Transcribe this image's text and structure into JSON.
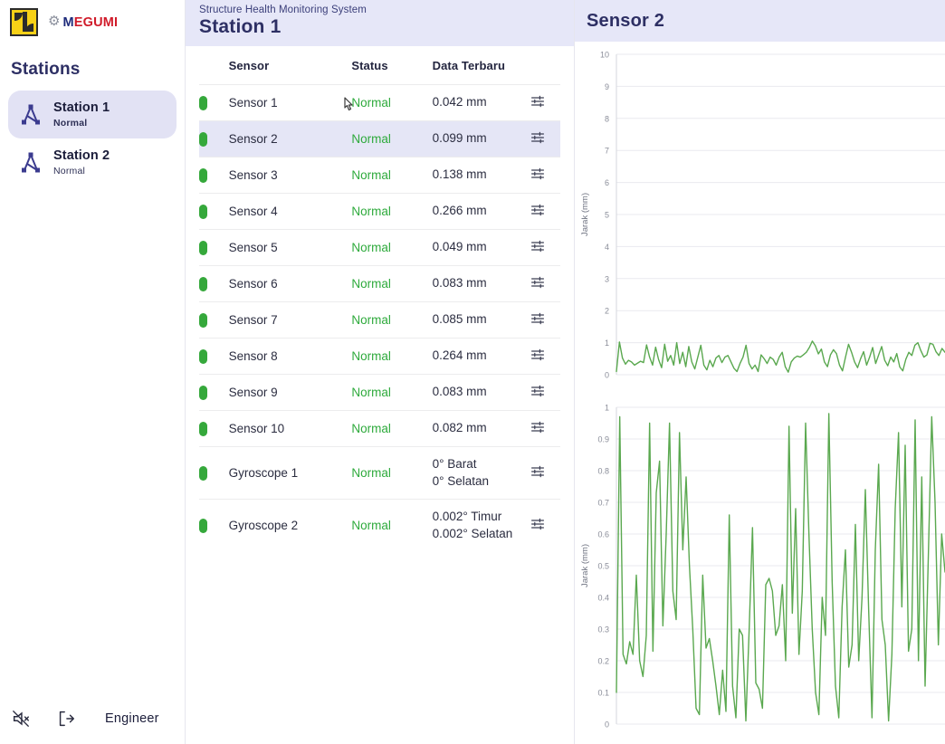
{
  "brand": {
    "logo_icon": "megumi-square-logo",
    "gear_icon": "gear-icon",
    "name_first": "M",
    "name_rest": "EGUMI"
  },
  "sidebar": {
    "heading": "Stations",
    "items": [
      {
        "icon": "station-tripod-icon",
        "label": "Station 1",
        "status": "Normal",
        "active": true
      },
      {
        "icon": "station-tripod-icon",
        "label": "Station 2",
        "status": "Normal",
        "active": false
      }
    ],
    "footer": {
      "mute_icon": "speaker-muted-icon",
      "logout_icon": "logout-icon",
      "user": "Engineer"
    }
  },
  "panel": {
    "subtitle": "Structure Health Monitoring System",
    "title": "Station 1",
    "columns": [
      "",
      "Sensor",
      "Status",
      "Data Terbaru",
      ""
    ],
    "action_icon": "sliders-icon",
    "rows": [
      {
        "indicator": "green",
        "sensor": "Sensor 1",
        "status": "Normal",
        "value": "0.042 mm",
        "selected": false
      },
      {
        "indicator": "green",
        "sensor": "Sensor 2",
        "status": "Normal",
        "value": "0.099 mm",
        "selected": true
      },
      {
        "indicator": "green",
        "sensor": "Sensor 3",
        "status": "Normal",
        "value": "0.138 mm",
        "selected": false
      },
      {
        "indicator": "green",
        "sensor": "Sensor 4",
        "status": "Normal",
        "value": "0.266 mm",
        "selected": false
      },
      {
        "indicator": "green",
        "sensor": "Sensor 5",
        "status": "Normal",
        "value": "0.049 mm",
        "selected": false
      },
      {
        "indicator": "green",
        "sensor": "Sensor 6",
        "status": "Normal",
        "value": "0.083 mm",
        "selected": false
      },
      {
        "indicator": "green",
        "sensor": "Sensor 7",
        "status": "Normal",
        "value": "0.085 mm",
        "selected": false
      },
      {
        "indicator": "green",
        "sensor": "Sensor 8",
        "status": "Normal",
        "value": "0.264 mm",
        "selected": false
      },
      {
        "indicator": "green",
        "sensor": "Sensor 9",
        "status": "Normal",
        "value": "0.083 mm",
        "selected": false
      },
      {
        "indicator": "green",
        "sensor": "Sensor 10",
        "status": "Normal",
        "value": "0.082 mm",
        "selected": false
      },
      {
        "indicator": "green",
        "sensor": "Gyroscope 1",
        "status": "Normal",
        "value": "0° Barat\n0° Selatan",
        "selected": false
      },
      {
        "indicator": "green",
        "sensor": "Gyroscope 2",
        "status": "Normal",
        "value": "0.002° Timur\n0.002° Selatan",
        "selected": false
      }
    ]
  },
  "charts_panel": {
    "title": "Sensor 2"
  },
  "colors": {
    "accent": "#2d2f64",
    "header_band": "#e6e7f8",
    "selected_row": "#e5e6f6",
    "status_green": "#2eaa3c",
    "line_green": "#5aa84f",
    "grid": "#e9e9ef"
  },
  "chart_data": [
    {
      "type": "line",
      "id": "sensor2-overview",
      "title": "",
      "xlabel": "",
      "ylabel": "Jarak (mm)",
      "ylim": [
        0,
        10
      ],
      "yticks": [
        0,
        1,
        2,
        3,
        4,
        5,
        6,
        7,
        8,
        9,
        10
      ],
      "grid": true,
      "legend": "none",
      "series": [
        {
          "name": "Jarak",
          "values": [
            0.1,
            1.02,
            0.52,
            0.33,
            0.45,
            0.4,
            0.3,
            0.36,
            0.42,
            0.38,
            0.93,
            0.55,
            0.3,
            0.86,
            0.47,
            0.22,
            0.95,
            0.42,
            0.6,
            0.3,
            1.0,
            0.35,
            0.7,
            0.25,
            0.88,
            0.4,
            0.18,
            0.55,
            0.92,
            0.3,
            0.15,
            0.45,
            0.25,
            0.52,
            0.6,
            0.38,
            0.55,
            0.6,
            0.4,
            0.2,
            0.1,
            0.35,
            0.55,
            0.92,
            0.35,
            0.18,
            0.3,
            0.1,
            0.62,
            0.5,
            0.35,
            0.55,
            0.48,
            0.3,
            0.55,
            0.7,
            0.25,
            0.08,
            0.4,
            0.52,
            0.58,
            0.55,
            0.62,
            0.7,
            0.85,
            1.05,
            0.9,
            0.65,
            0.8,
            0.4,
            0.25,
            0.62,
            0.78,
            0.66,
            0.3,
            0.12,
            0.55,
            0.95,
            0.7,
            0.4,
            0.22,
            0.5,
            0.72,
            0.3,
            0.55,
            0.85,
            0.35,
            0.62,
            0.88,
            0.45,
            0.28,
            0.55,
            0.4,
            0.66,
            0.24,
            0.12,
            0.48,
            0.7,
            0.6,
            0.92,
            1.0,
            0.75,
            0.55,
            0.62,
            0.98,
            0.95,
            0.72,
            0.6,
            0.82,
            0.7
          ]
        }
      ]
    },
    {
      "type": "line",
      "id": "sensor2-detail",
      "title": "",
      "xlabel": "",
      "ylabel": "Jarak (mm)",
      "ylim": [
        0,
        1.0
      ],
      "yticks": [
        0,
        0.1,
        0.2,
        0.3,
        0.4,
        0.5,
        0.6,
        0.7,
        0.8,
        0.9,
        1.0
      ],
      "grid": true,
      "legend": "none",
      "series": [
        {
          "name": "Jarak",
          "values": [
            0.1,
            0.97,
            0.22,
            0.19,
            0.26,
            0.22,
            0.47,
            0.2,
            0.15,
            0.28,
            0.95,
            0.23,
            0.73,
            0.83,
            0.31,
            0.6,
            0.95,
            0.42,
            0.33,
            0.92,
            0.55,
            0.78,
            0.5,
            0.3,
            0.05,
            0.03,
            0.47,
            0.24,
            0.27,
            0.2,
            0.12,
            0.03,
            0.17,
            0.04,
            0.66,
            0.12,
            0.02,
            0.3,
            0.28,
            0.01,
            0.3,
            0.62,
            0.13,
            0.11,
            0.05,
            0.44,
            0.46,
            0.42,
            0.28,
            0.31,
            0.44,
            0.2,
            0.94,
            0.35,
            0.68,
            0.22,
            0.42,
            0.95,
            0.6,
            0.3,
            0.1,
            0.03,
            0.4,
            0.28,
            0.98,
            0.45,
            0.12,
            0.02,
            0.37,
            0.55,
            0.18,
            0.25,
            0.63,
            0.2,
            0.4,
            0.74,
            0.36,
            0.02,
            0.55,
            0.82,
            0.33,
            0.25,
            0.01,
            0.22,
            0.68,
            0.92,
            0.37,
            0.88,
            0.23,
            0.3,
            0.96,
            0.2,
            0.78,
            0.12,
            0.54,
            0.97,
            0.7,
            0.25,
            0.6,
            0.48
          ]
        }
      ]
    }
  ]
}
